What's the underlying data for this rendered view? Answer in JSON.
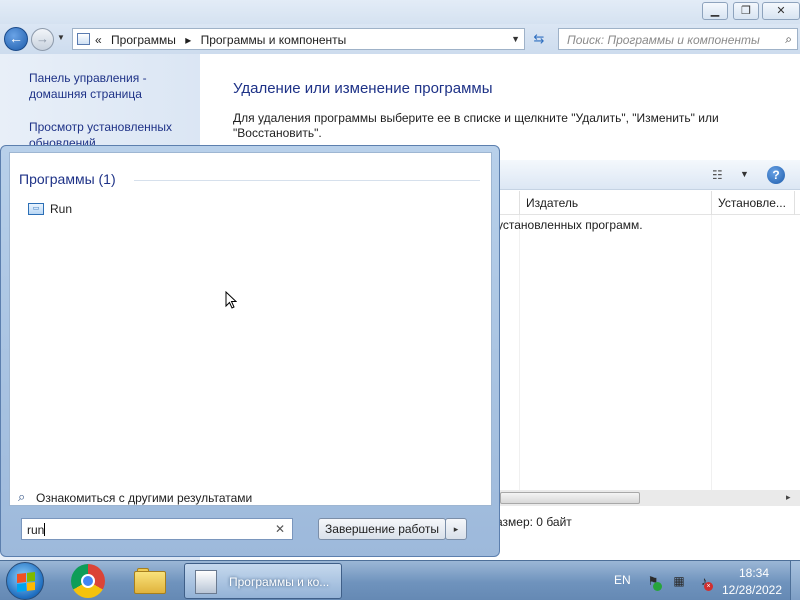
{
  "explorer": {
    "window_controls": {
      "minimize": "▁",
      "maximize": "❐",
      "close": "✕"
    },
    "navigation": {
      "back": "←",
      "forward": "→",
      "history": "▼"
    },
    "address": {
      "chevron": "«",
      "crumbs": [
        "Программы",
        "▸",
        "Программы и компоненты"
      ],
      "dropdown": "▼"
    },
    "refresh": "⇆",
    "search": {
      "placeholder": "Поиск: Программы и компоненты",
      "icon": "search-icon"
    },
    "left_pane": {
      "home_link": "Панель управления - домашняя страница",
      "updates_link": "Просмотр установленных обновлений"
    },
    "main": {
      "title": "Удаление или изменение программы",
      "description": "Для удаления программы выберите ее в списке и щелкните \"Удалить\", \"Изменить\" или \"Восстановить\"."
    },
    "toolbar": {
      "view_icon": "☷",
      "view_dropdown": "▼",
      "help": "?"
    },
    "columns": [
      "Издатель",
      "Установле..."
    ],
    "empty_message": "установленных программ.",
    "status_size": "азмер: 0 байт",
    "scroll_arrow": "▸"
  },
  "start_menu": {
    "group_header": "Программы (1)",
    "items": [
      {
        "label": "Run",
        "icon": "run-icon"
      }
    ],
    "more_results": "Ознакомиться с другими результатами",
    "search_value": "run",
    "search_clear": "✕",
    "shutdown_label": "Завершение работы",
    "shutdown_arrow": "▸"
  },
  "taskbar": {
    "task_label": "Программы и ко...",
    "language": "EN",
    "time": "18:34",
    "date": "12/28/2022",
    "tray": {
      "flag": "⚑",
      "network": "▦",
      "volume": "♪",
      "ok_badge": "",
      "x_badge": "×"
    }
  },
  "colors": {
    "link_blue": "#1e3287",
    "taskbar": "#6f93bd",
    "start_menu_frame": "#b8d0ea",
    "win_flag": [
      "#f25022",
      "#7fba00",
      "#00a4ef",
      "#ffb900"
    ]
  }
}
